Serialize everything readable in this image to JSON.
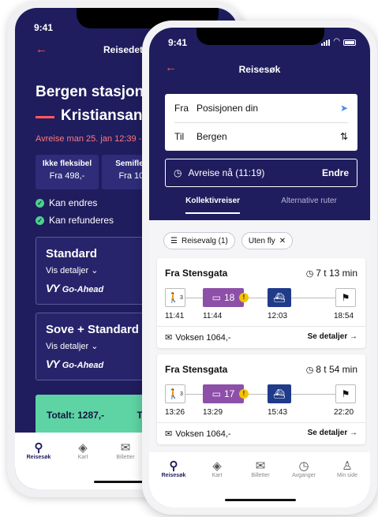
{
  "colors": {
    "navy": "#1f1d5e",
    "accent": "#ff5a5f",
    "green": "#5ed3a4",
    "bus": "#8e4fa8",
    "boat": "#1f3b8a",
    "warning": "#f5c400"
  },
  "back_phone": {
    "time": "9:41",
    "back_icon": "arrow-left-icon",
    "title": "Reisedetal",
    "from": "Bergen stasjon",
    "to": "Kristiansand",
    "departure": "Avreise man 25. jan 12:39 - 0",
    "tabs": [
      {
        "name": "Ikke fleksibel",
        "price": "Fra 498,-"
      },
      {
        "name": "Semifleksib",
        "price": "Fra 1088,"
      }
    ],
    "conditions": [
      "Kan endres",
      "Kan refunderes"
    ],
    "cards": [
      {
        "name": "Standard",
        "details": "Vis detaljer",
        "logo": "Go-Ahead"
      },
      {
        "name": "Sove + Standard",
        "details": "Vis detaljer",
        "logo": "Go-Ahead"
      }
    ],
    "logo_prefix": "VY",
    "total": "Totalt: 1287,-",
    "total_tail": "T",
    "nav": [
      {
        "label": "Reisesøk",
        "icon": "search-icon"
      },
      {
        "label": "Kart",
        "icon": "map-icon"
      },
      {
        "label": "Billetter",
        "icon": "ticket-icon"
      }
    ]
  },
  "front_phone": {
    "time": "9:41",
    "back_icon": "arrow-left-icon",
    "title": "Reisesøk",
    "search": {
      "from_label": "Fra",
      "from_value": "Posisjonen din",
      "to_label": "Til",
      "to_value": "Bergen"
    },
    "departure": {
      "text": "Avreise nå (11:19)",
      "button": "Endre"
    },
    "tabs": [
      "Kollektivreiser",
      "Alternative ruter"
    ],
    "chips": [
      {
        "label": "Reisevalg (1)",
        "icon": "sliders-icon"
      },
      {
        "label": "Uten fly",
        "icon": "close-icon"
      }
    ],
    "trips": [
      {
        "from": "Fra Stensgata",
        "duration": "7 t 13 min",
        "walk_minutes": "3",
        "bus_line": "18",
        "times": [
          "11:41",
          "11:44",
          "12:03",
          "18:54"
        ],
        "price": "Voksen 1064,-",
        "details": "Se detaljer →"
      },
      {
        "from": "Fra Stensgata",
        "duration": "8 t 54 min",
        "walk_minutes": "3",
        "bus_line": "17",
        "times": [
          "13:26",
          "13:29",
          "15:43",
          "22:20"
        ],
        "price": "Voksen 1064,-",
        "details": "Se detaljer →"
      }
    ],
    "nav": [
      {
        "label": "Reisesøk",
        "icon": "search-icon"
      },
      {
        "label": "Kart",
        "icon": "map-icon"
      },
      {
        "label": "Billetter",
        "icon": "ticket-icon"
      },
      {
        "label": "Avganger",
        "icon": "clock-icon"
      },
      {
        "label": "Min side",
        "icon": "person-icon"
      }
    ]
  }
}
